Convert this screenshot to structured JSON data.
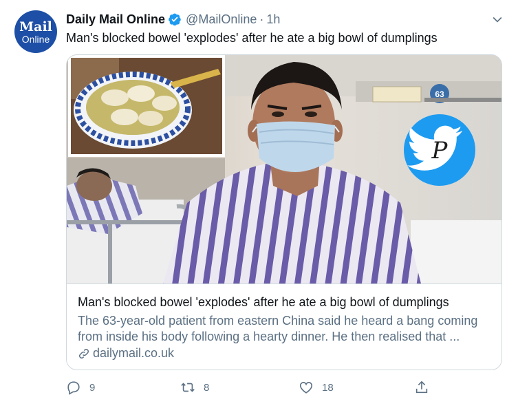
{
  "account": {
    "avatar_line1": "Mail",
    "avatar_line2": "Online",
    "name": "Daily Mail Online",
    "handle": "@MailOnline",
    "separator": "·",
    "time": "1h"
  },
  "tweet": {
    "text": "Man's blocked bowel 'explodes' after he ate a big bowl of dumplings"
  },
  "card": {
    "title": "Man's blocked bowel 'explodes' after he ate a big bowl of dumplings",
    "description_line1": "The 63-year-old patient from eastern China said he heard a bang coming",
    "description_line2": "from inside his body following a hearty dinner. He then realised that ...",
    "domain": "dailymail.co.uk",
    "room_number": "63"
  },
  "actions": {
    "replies": "9",
    "retweets": "8",
    "likes": "18"
  },
  "colors": {
    "twitter_blue": "#1d9bf0",
    "secondary_text": "#5b7083",
    "border": "#cfd9de",
    "mail_blue": "#1d4fa6"
  },
  "icons": [
    "verified-badge-icon",
    "chevron-down-icon",
    "link-icon",
    "reply-icon",
    "retweet-icon",
    "like-icon",
    "share-icon",
    "twitter-bird-icon"
  ]
}
